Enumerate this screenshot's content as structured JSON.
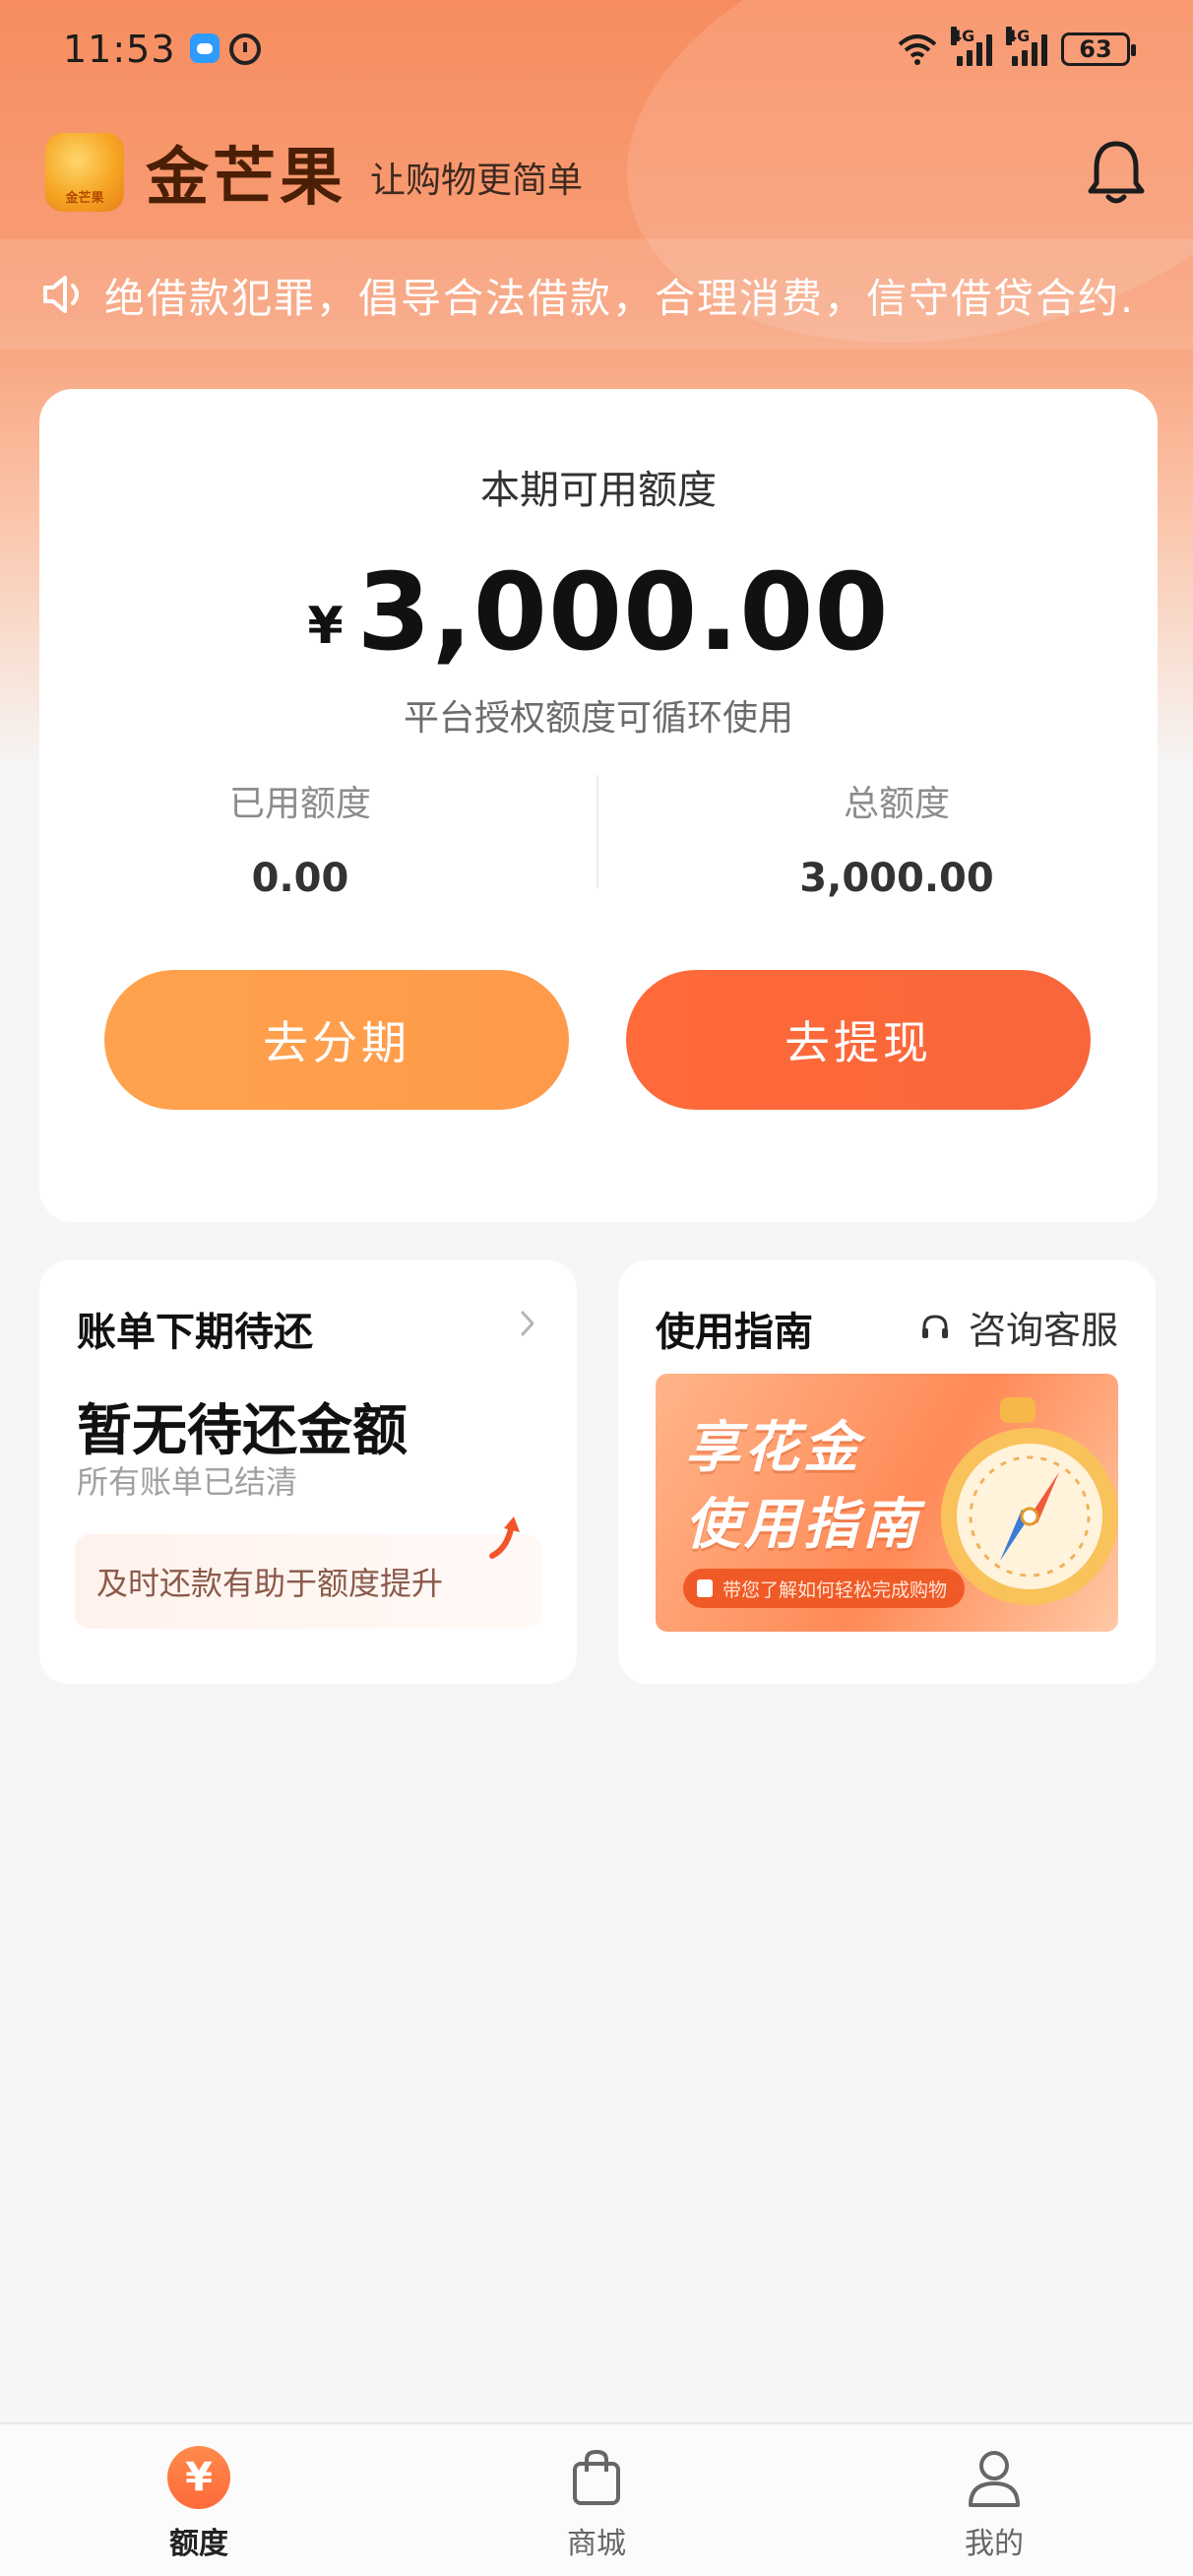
{
  "status_bar": {
    "time": "11:53",
    "battery": "63",
    "network": [
      "4G",
      "4G"
    ]
  },
  "header": {
    "brand": "金芒果",
    "slogan": "让购物更简单",
    "logo_text": "金芒果"
  },
  "notice": {
    "text": "绝借款犯罪，倡导合法借款，合理消费，信守借贷合约."
  },
  "credit": {
    "title": "本期可用额度",
    "currency": "¥",
    "available": "3,000.00",
    "note": "平台授权额度可循环使用",
    "used_label": "已用额度",
    "used_value": "0.00",
    "total_label": "总额度",
    "total_value": "3,000.00",
    "installment_button": "去分期",
    "withdraw_button": "去提现"
  },
  "bill_card": {
    "title": "账单下期待还",
    "status": "暂无待还金额",
    "sub": "所有账单已结清",
    "tip": "及时还款有助于额度提升"
  },
  "guide_card": {
    "title": "使用指南",
    "service": "咨询客服",
    "banner_line1": "享花金",
    "banner_line2": "使用指南",
    "banner_pill": "带您了解如何轻松完成购物"
  },
  "tabs": [
    {
      "label": "额度",
      "icon": "yen-icon",
      "active": true
    },
    {
      "label": "商城",
      "icon": "shopping-bag-icon",
      "active": false
    },
    {
      "label": "我的",
      "icon": "person-icon",
      "active": false
    }
  ],
  "colors": {
    "accent": "#ff6a3a",
    "secondary": "#ffa24d",
    "brand_text": "#4a1f05"
  }
}
